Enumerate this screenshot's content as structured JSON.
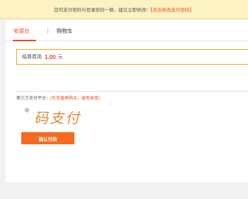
{
  "notice": {
    "message": "您的支付密码与登录密码一致，建议立即修改!",
    "link": "【点击修改支付密码】"
  },
  "tabs": [
    {
      "label": "收银台",
      "active": true
    },
    {
      "label": "购物车",
      "active": false
    }
  ],
  "total": {
    "label": "结算费用",
    "amount": "1.00",
    "unit": "元"
  },
  "payment": {
    "label": "第三方支付平台：",
    "note": "(先充值再购买，避免掉单)",
    "method_logo_text": "码支付",
    "selected": true
  },
  "confirm_button": "确认付款",
  "colors": {
    "accent": "#e94a26",
    "button": "#f66b20",
    "notice_bg": "#fdf2c2",
    "total_border": "#f5a623"
  }
}
